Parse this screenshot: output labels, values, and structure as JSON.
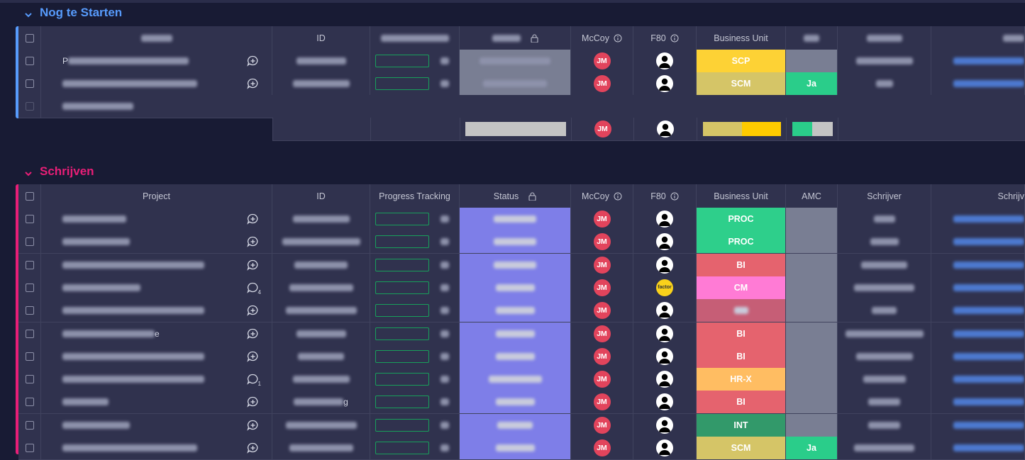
{
  "groups": [
    {
      "title": "Nog te Starten",
      "color": "#579bfc",
      "columns": {
        "project": "",
        "id": "ID",
        "progress": "",
        "status": "",
        "mccoy": "McCoy",
        "f80": "F80",
        "business_unit": "Business Unit",
        "amc": "",
        "schrijver": "",
        "schrijver2": ""
      },
      "rows": [
        {
          "project_prefix": "P",
          "owner_initials": "JM",
          "business_unit": "SCP",
          "bu_color": "#fdd235",
          "status_color": "#797e93",
          "amc": "",
          "amc_color": "#797e93",
          "f80": "person"
        },
        {
          "project_prefix": "",
          "owner_initials": "JM",
          "business_unit": "SCM",
          "bu_color": "#d5c567",
          "status_color": "#797e93",
          "amc": "Ja",
          "amc_color": "#2acd8a",
          "f80": "person"
        }
      ],
      "summary": {
        "owner_initials": "JM",
        "bu_colors": [
          "#d5c567",
          "#ffcb00"
        ],
        "amc_colors": [
          "#2acd8a",
          "#c4c4c4"
        ]
      }
    },
    {
      "title": "Schrijven",
      "color": "#e81e77",
      "columns": {
        "project": "Project",
        "id": "ID",
        "progress": "Progress Tracking",
        "status": "Status",
        "mccoy": "McCoy",
        "f80": "F80",
        "business_unit": "Business Unit",
        "amc": "AMC",
        "schrijver": "Schrijver",
        "schrijver2": "Schrijv"
      },
      "rows": [
        {
          "owner_initials": "JM",
          "business_unit": "PROC",
          "bu_color": "#2ecf8b",
          "f80": "person",
          "comments": "",
          "id_suffix": ""
        },
        {
          "owner_initials": "JM",
          "business_unit": "PROC",
          "bu_color": "#2ecf8b",
          "f80": "person",
          "comments": "",
          "id_suffix": ""
        },
        {
          "owner_initials": "JM",
          "business_unit": "BI",
          "bu_color": "#e5636e",
          "f80": "person",
          "comments": "",
          "id_suffix": ""
        },
        {
          "owner_initials": "JM",
          "business_unit": "CM",
          "bu_color": "#ff7bd5",
          "f80": "factor",
          "comments": "4",
          "id_suffix": ""
        },
        {
          "owner_initials": "JM",
          "business_unit": "",
          "bu_color": "#c65e76",
          "f80": "person",
          "comments": "",
          "id_suffix": ""
        },
        {
          "owner_initials": "JM",
          "business_unit": "BI",
          "bu_color": "#e5636e",
          "f80": "person",
          "comments": "",
          "id_suffix": "",
          "project_suffix": "e"
        },
        {
          "owner_initials": "JM",
          "business_unit": "BI",
          "bu_color": "#e5636e",
          "f80": "person",
          "comments": "",
          "id_suffix": ""
        },
        {
          "owner_initials": "JM",
          "business_unit": "HR-X",
          "bu_color": "#ffbd62",
          "f80": "person",
          "comments": "1",
          "id_suffix": ""
        },
        {
          "owner_initials": "JM",
          "business_unit": "BI",
          "bu_color": "#e5636e",
          "f80": "person",
          "comments": "",
          "id_suffix": "g"
        },
        {
          "owner_initials": "JM",
          "business_unit": "INT",
          "bu_color": "#32996a",
          "f80": "person",
          "comments": "",
          "id_suffix": ""
        },
        {
          "owner_initials": "JM",
          "business_unit": "SCM",
          "bu_color": "#d5c567",
          "f80": "person",
          "comments": "",
          "id_suffix": "",
          "amc": "Ja"
        }
      ]
    }
  ],
  "factor_label": "factor",
  "colors": {
    "status_purple": "#7e7ee8",
    "amc_gray": "#797e93",
    "avatar_red": "#e2445c"
  }
}
